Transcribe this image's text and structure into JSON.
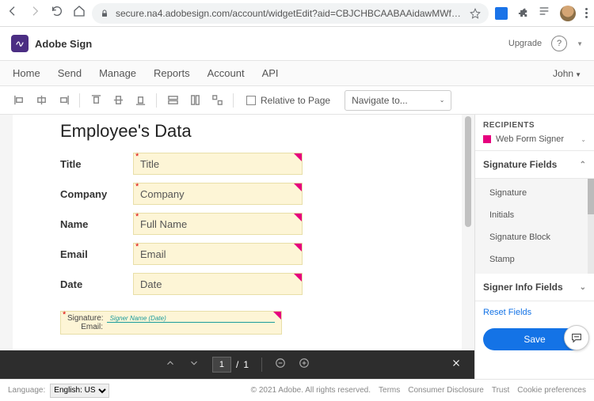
{
  "browser": {
    "url": "secure.na4.adobesign.com/account/widgetEdit?aid=CBJCHBCAABAAidawMWfFChqJ6GUkFpl5k1qY..."
  },
  "app": {
    "name": "Adobe Sign",
    "upgrade": "Upgrade"
  },
  "nav": {
    "items": [
      "Home",
      "Send",
      "Manage",
      "Reports",
      "Account",
      "API"
    ],
    "user": "John"
  },
  "toolbar": {
    "relative_to_page": "Relative to Page",
    "navigate_to": "Navigate to..."
  },
  "doc": {
    "title": "Employee's Data",
    "fields": [
      {
        "label": "Title",
        "placeholder": "Title"
      },
      {
        "label": "Company",
        "placeholder": "Company"
      },
      {
        "label": "Name",
        "placeholder": "Full Name"
      },
      {
        "label": "Email",
        "placeholder": "Email"
      },
      {
        "label": "Date",
        "placeholder": "Date"
      }
    ],
    "sig_block": {
      "signature_label": "Signature:",
      "signer_hint": "Signer Name (Date)",
      "email_label": "Email:"
    }
  },
  "pager": {
    "current": "1",
    "total": "1"
  },
  "panel": {
    "recipients_title": "RECIPIENTS",
    "recipient": "Web Form Signer",
    "sig_fields_title": "Signature Fields",
    "sig_fields": [
      "Signature",
      "Initials",
      "Signature Block",
      "Stamp"
    ],
    "signer_info_title": "Signer Info Fields",
    "reset": "Reset Fields",
    "save": "Save"
  },
  "footer": {
    "language_label": "Language:",
    "language": "English: US",
    "copyright": "© 2021 Adobe. All rights reserved.",
    "links": [
      "Terms",
      "Consumer Disclosure",
      "Trust",
      "Cookie preferences"
    ]
  }
}
